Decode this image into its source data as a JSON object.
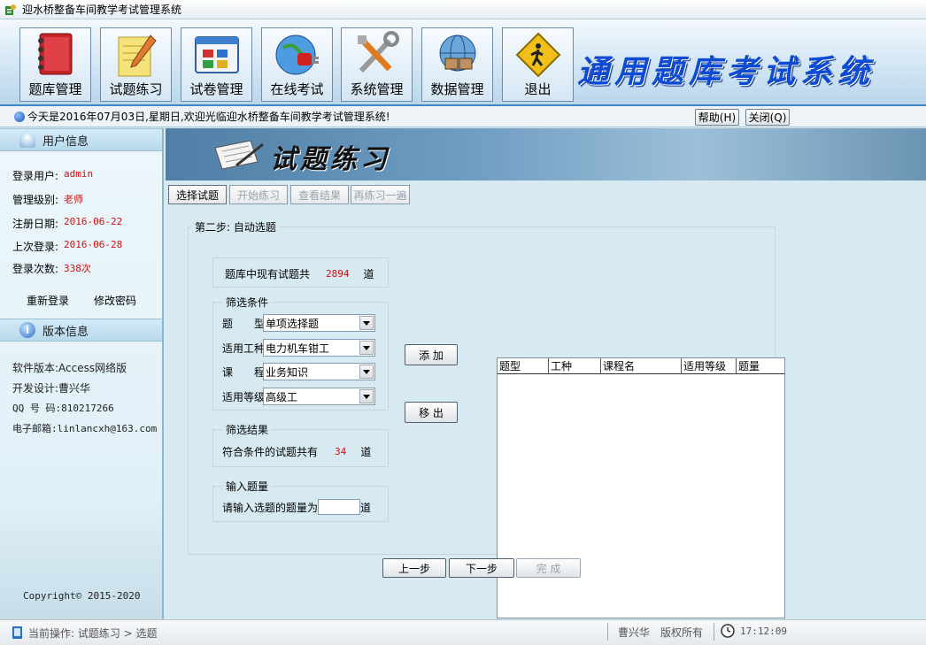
{
  "window": {
    "title": "迎水桥整备车间教学考试管理系统"
  },
  "toolbar": {
    "items": [
      {
        "label": "题库管理",
        "icon": "book-icon"
      },
      {
        "label": "试题练习",
        "icon": "notepad-pencil-icon"
      },
      {
        "label": "试卷管理",
        "icon": "window-grid-icon"
      },
      {
        "label": "在线考试",
        "icon": "globe-plug-icon"
      },
      {
        "label": "系统管理",
        "icon": "tools-icon"
      },
      {
        "label": "数据管理",
        "icon": "network-icon"
      },
      {
        "label": "退出",
        "icon": "exit-sign-icon"
      }
    ],
    "banner_title": "通用题库考试系统"
  },
  "welcome": {
    "text": "今天是2016年07月03日,星期日,欢迎光临迎水桥整备车间教学考试管理系统!",
    "help_label": "帮助(H)",
    "close_label": "关闭(Q)"
  },
  "sidebar": {
    "user_section_title": "用户信息",
    "user_rows": [
      {
        "label": "登录用户:",
        "value": "admin"
      },
      {
        "label": "管理级别:",
        "value": "老师"
      },
      {
        "label": "注册日期:",
        "value": "2016-06-22"
      },
      {
        "label": "上次登录:",
        "value": "2016-06-28"
      },
      {
        "label": "登录次数:",
        "value": "338次"
      }
    ],
    "relogin_label": "重新登录",
    "change_password_label": "修改密码",
    "version_section_title": "版本信息",
    "version_rows": [
      {
        "text": "软件版本:Access网络版"
      },
      {
        "text": "开发设计:曹兴华"
      },
      {
        "text": "QQ 号 码:810217266"
      },
      {
        "text": "电子邮箱:linlancxh@163.com"
      }
    ],
    "copyright": "Copyright© 2015-2020"
  },
  "main": {
    "banner_title": "试题练习",
    "steps": [
      {
        "label": "选择试题",
        "enabled": true
      },
      {
        "label": "开始练习",
        "enabled": false
      },
      {
        "label": "查看结果",
        "enabled": false
      },
      {
        "label": "再练习一遍",
        "enabled": false
      }
    ],
    "group_title": "第二步: 自动选题",
    "total": {
      "prefix": "题库中现有试题共",
      "value": "2894",
      "suffix": "道"
    },
    "filter": {
      "title": "筛选条件",
      "rows": [
        {
          "label": "题　　型",
          "value": "单项选择题"
        },
        {
          "label": "适用工种",
          "value": "电力机车钳工"
        },
        {
          "label": "课　　程",
          "value": "业务知识"
        },
        {
          "label": "适用等级",
          "value": "高级工"
        }
      ]
    },
    "result": {
      "title": "筛选结果",
      "prefix": "符合条件的试题共有",
      "value": "34",
      "suffix": "道"
    },
    "input": {
      "title": "输入题量",
      "prefix": "请输入选题的题量为",
      "value": "",
      "suffix": "道"
    },
    "add_label": "添 加",
    "remove_label": "移 出",
    "list_columns": [
      "题型",
      "工种",
      "课程名",
      "适用等级",
      "题量"
    ],
    "prev_label": "上一步",
    "next_label": "下一步",
    "finish_label": "完 成"
  },
  "status": {
    "current_op": "当前操作: 试题练习 > 选题",
    "owner": "曹兴华　版权所有",
    "time": "17:12:09"
  },
  "colors": {
    "accent": "#0d4bd4",
    "value_red": "#d01010",
    "header_blue": "#3f86c6"
  }
}
